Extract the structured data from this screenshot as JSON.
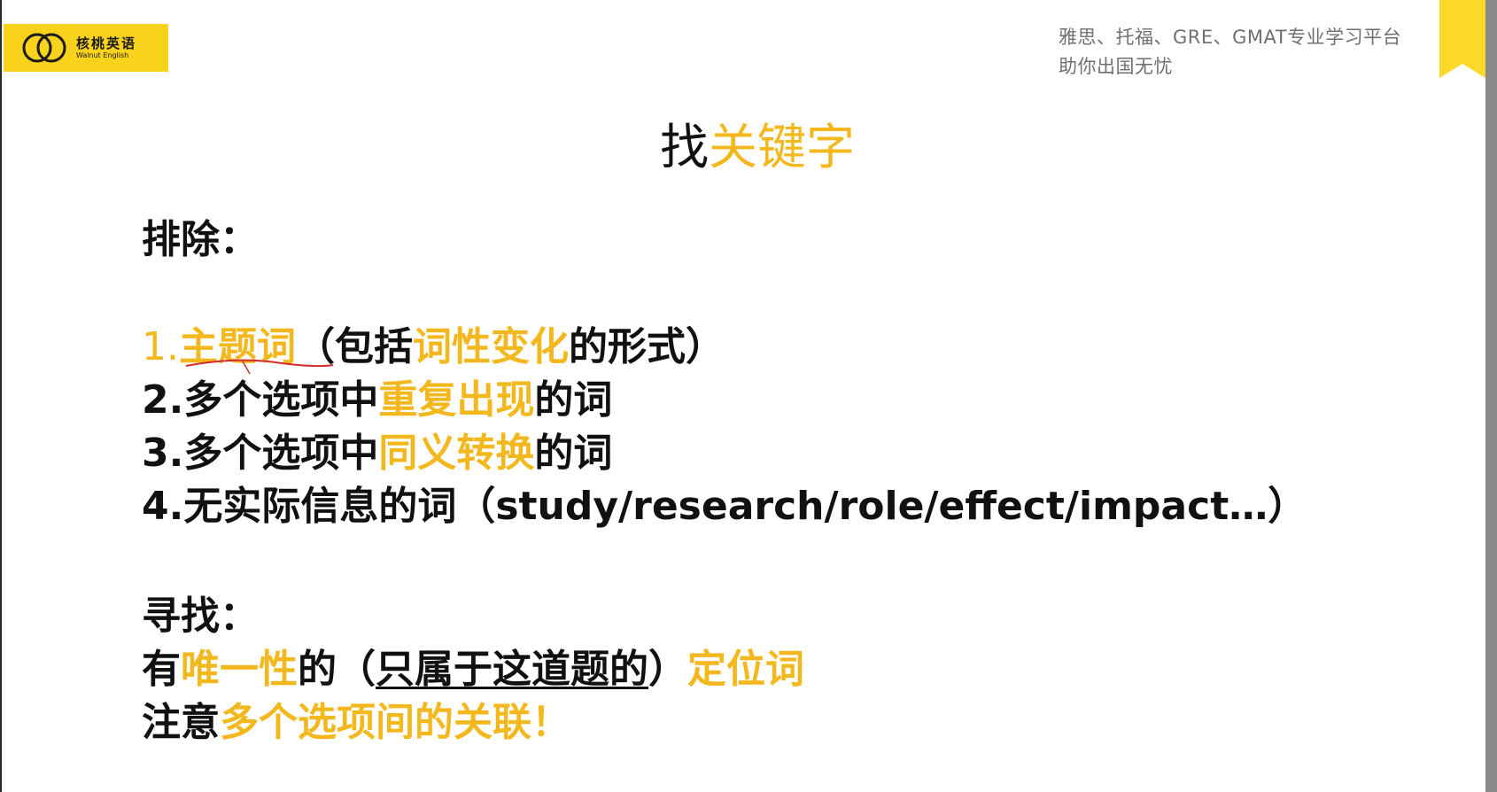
{
  "header": {
    "logo_cn": "核桃英语",
    "logo_en": "Walnut English",
    "tagline_1": "雅思、托福、GRE、GMAT专业学习平台",
    "tagline_2": "助你出国无忧"
  },
  "title": {
    "part1": "找",
    "part2": "关键字"
  },
  "exclude": {
    "heading": "排除：",
    "item1": {
      "num": "1.",
      "a": "主题词",
      "b": "（包括",
      "c": "词性变化",
      "d": "的形式）"
    },
    "item2": {
      "a": "2.多个选项中",
      "b": "重复出现",
      "c": "的词"
    },
    "item3": {
      "a": "3.多个选项中",
      "b": "同义转换",
      "c": "的词"
    },
    "item4": {
      "a": "4.无实际信息的词（study/research/role/effect/impact…）"
    }
  },
  "find": {
    "heading": "寻找：",
    "line1": {
      "a": "有",
      "b": "唯一性",
      "c": "的（",
      "d": "只属于这道题的",
      "e": "）",
      "f": "定位词"
    },
    "line2": {
      "a": "注意",
      "b": "多个选项间的关联！"
    }
  },
  "colors": {
    "accent": "#f3b81e",
    "logo_bg": "#f9d21c",
    "text": "#111111",
    "tagline": "#707070",
    "annotation": "#d42a2a"
  }
}
